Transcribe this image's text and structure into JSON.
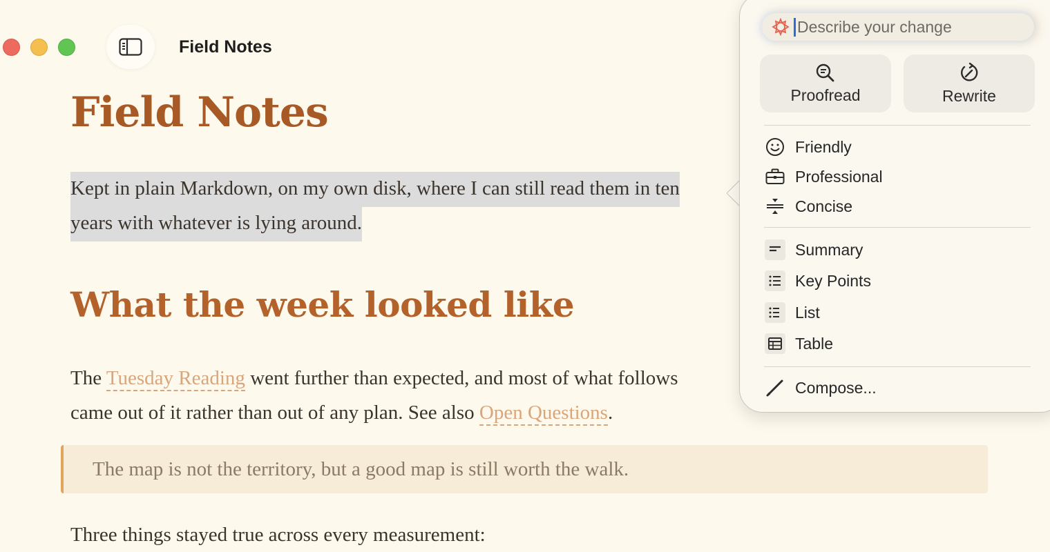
{
  "window": {
    "title": "Field Notes"
  },
  "document": {
    "title": "Field Notes",
    "intro_line1": "Kept in plain Markdown, on my own disk, where I can still read them in ten",
    "intro_line2": "years with whatever is lying around.",
    "heading": "What the week looked like",
    "p2_before": "The ",
    "p2_link1": "Tuesday Reading",
    "p2_middle": " went further than expected, and most of what follows",
    "p2_line2": "came out of it rather than out of any plan. See also ",
    "p2_link2": "Open Questions",
    "p2_end": ".",
    "quote": "The map is not the territory, but a good map is still worth the walk.",
    "p3": "Three things stayed true across every measurement:"
  },
  "writing_tools": {
    "prompt_placeholder": "Describe your change",
    "proofread_label": "Proofread",
    "rewrite_label": "Rewrite",
    "tone_items": {
      "friendly": "Friendly",
      "professional": "Professional",
      "concise": "Concise"
    },
    "format_items": {
      "summary": "Summary",
      "key_points": "Key Points",
      "list": "List",
      "table": "Table"
    },
    "compose_label": "Compose..."
  },
  "colors": {
    "background": "#fdf9ed",
    "title_accent": "#a85a26",
    "link": "#d9a57b",
    "quote_bar": "#dfa55a",
    "selection": "#dcdcdc"
  }
}
